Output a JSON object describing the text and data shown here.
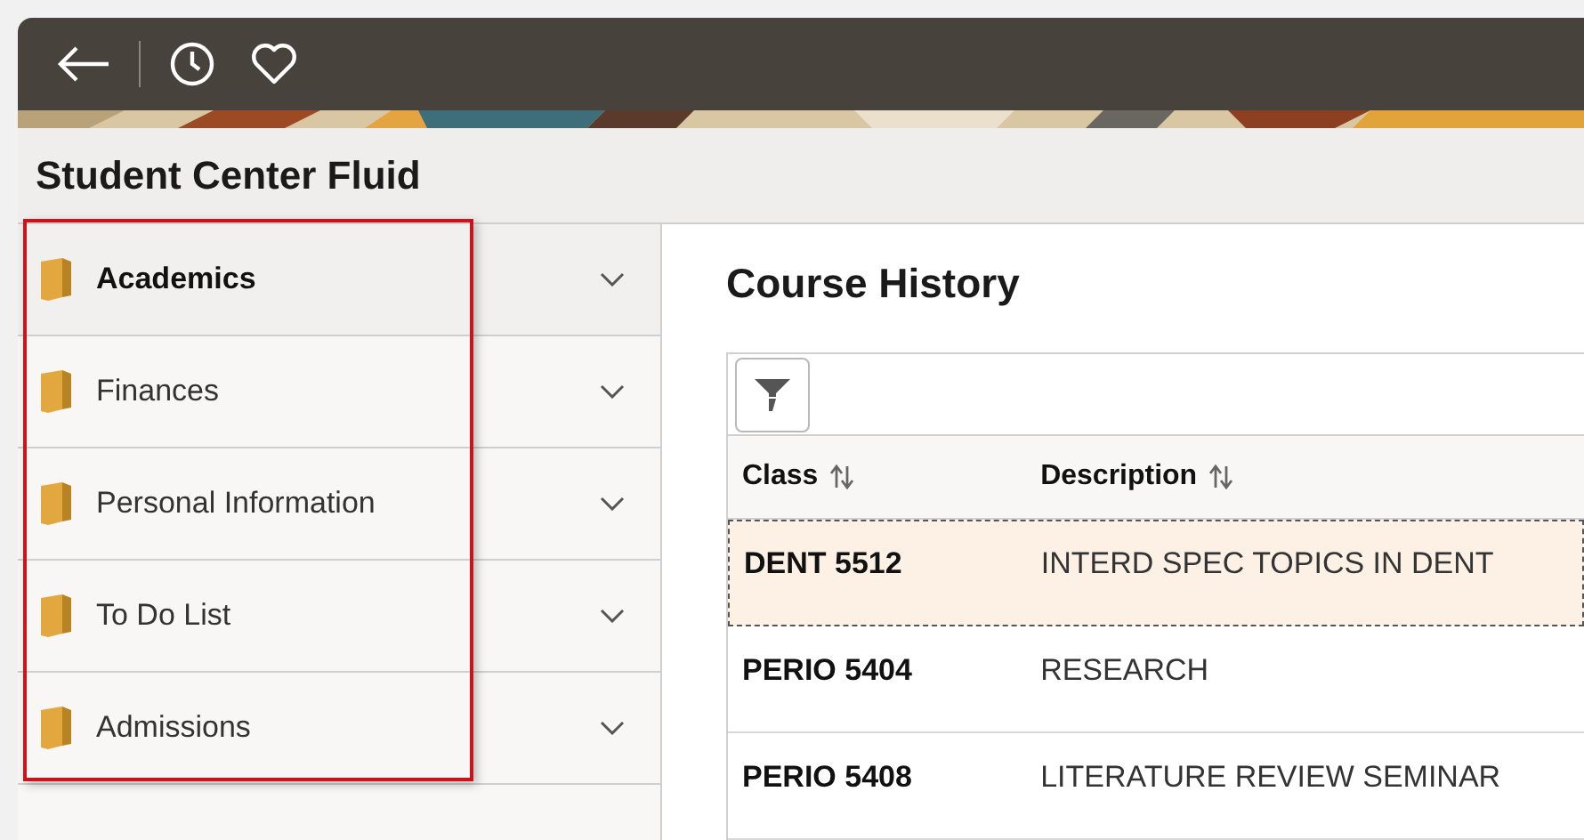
{
  "page_title": "Student Center Fluid",
  "sidebar": {
    "items": [
      {
        "label": "Academics",
        "selected": true
      },
      {
        "label": "Finances",
        "selected": false
      },
      {
        "label": "Personal Information",
        "selected": false
      },
      {
        "label": "To Do List",
        "selected": false
      },
      {
        "label": "Admissions",
        "selected": false
      }
    ]
  },
  "content": {
    "title": "Course History",
    "table": {
      "columns": [
        "Class",
        "Description"
      ],
      "rows": [
        {
          "cells": [
            "DENT 5512",
            "INTERD SPEC TOPICS IN DENT"
          ],
          "selected": true
        },
        {
          "cells": [
            "PERIO 5404",
            "RESEARCH"
          ],
          "selected": false
        },
        {
          "cells": [
            "PERIO 5408",
            "LITERATURE REVIEW SEMINAR"
          ],
          "selected": false
        }
      ]
    }
  }
}
